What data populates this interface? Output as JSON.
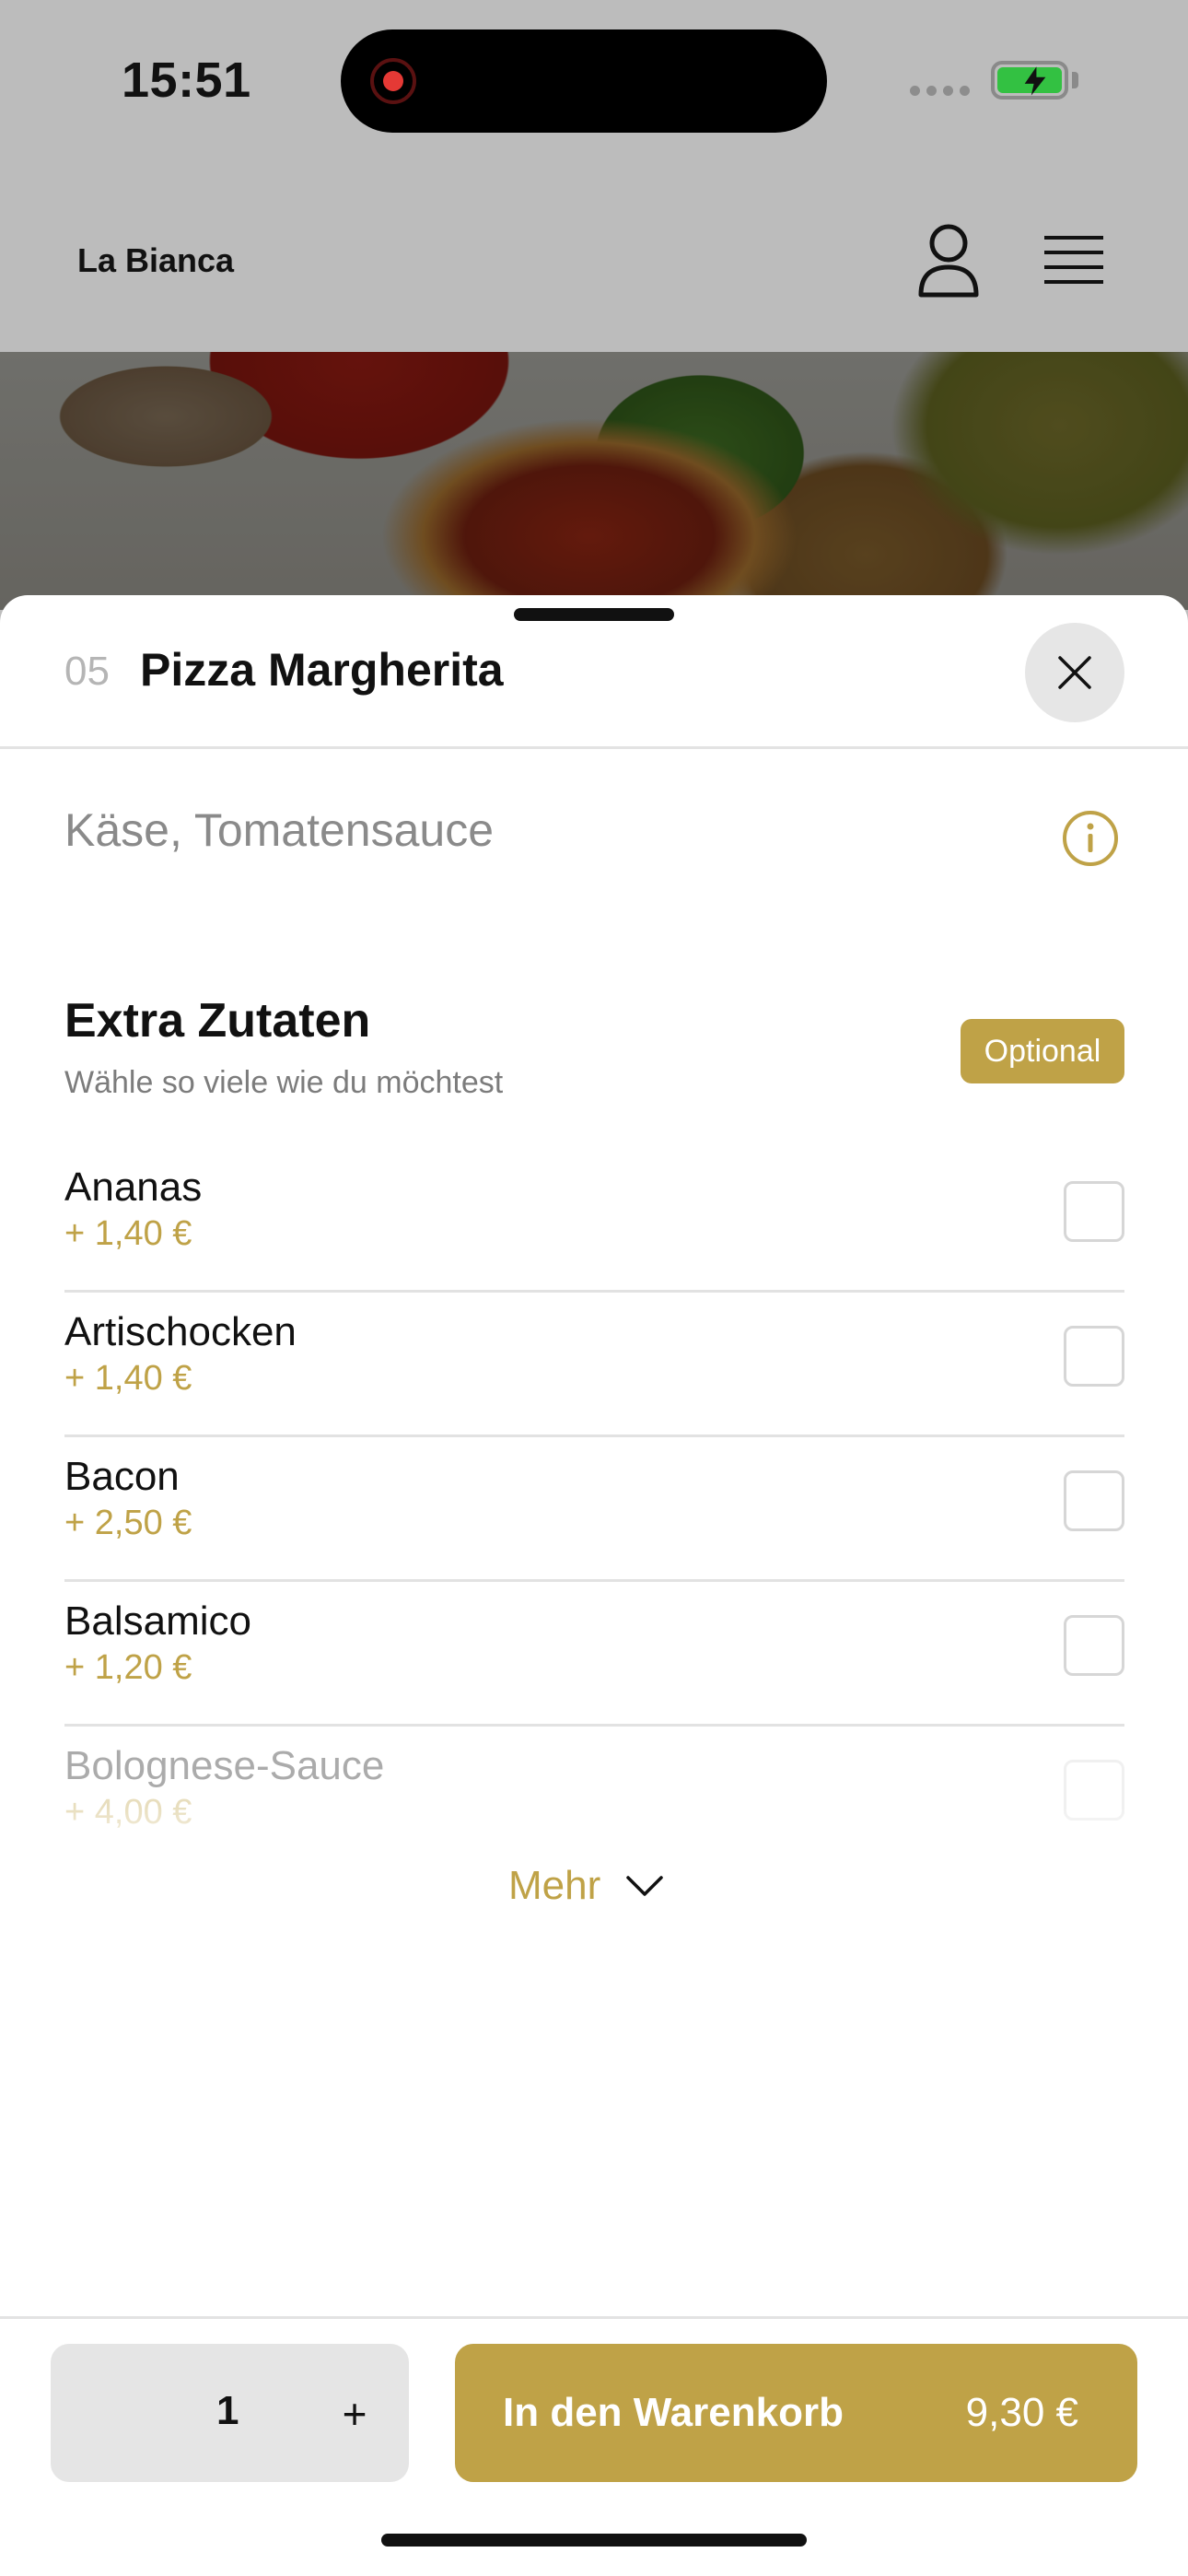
{
  "status_bar": {
    "time": "15:51"
  },
  "header": {
    "brand": "La Bianca"
  },
  "item": {
    "number": "05",
    "title": "Pizza Margherita",
    "ingredients": "Käse, Tomatensauce"
  },
  "extras": {
    "title": "Extra Zutaten",
    "subtitle": "Wähle so viele wie du möchtest",
    "badge": "Optional",
    "items": [
      {
        "name": "Ananas",
        "price": "+ 1,40 €"
      },
      {
        "name": "Artischocken",
        "price": "+ 1,40 €"
      },
      {
        "name": "Bacon",
        "price": "+ 2,50 €"
      },
      {
        "name": "Balsamico",
        "price": "+ 1,20 €"
      },
      {
        "name": "Bolognese-Sauce",
        "price": "+ 4,00 €"
      }
    ],
    "more_label": "Mehr"
  },
  "footer": {
    "quantity": "1",
    "plus_label": "+",
    "cart_label": "In den Warenkorb",
    "cart_price": "9,30 €"
  },
  "colors": {
    "accent": "#bfa247",
    "battery": "#33c142",
    "record": "#e53935"
  }
}
